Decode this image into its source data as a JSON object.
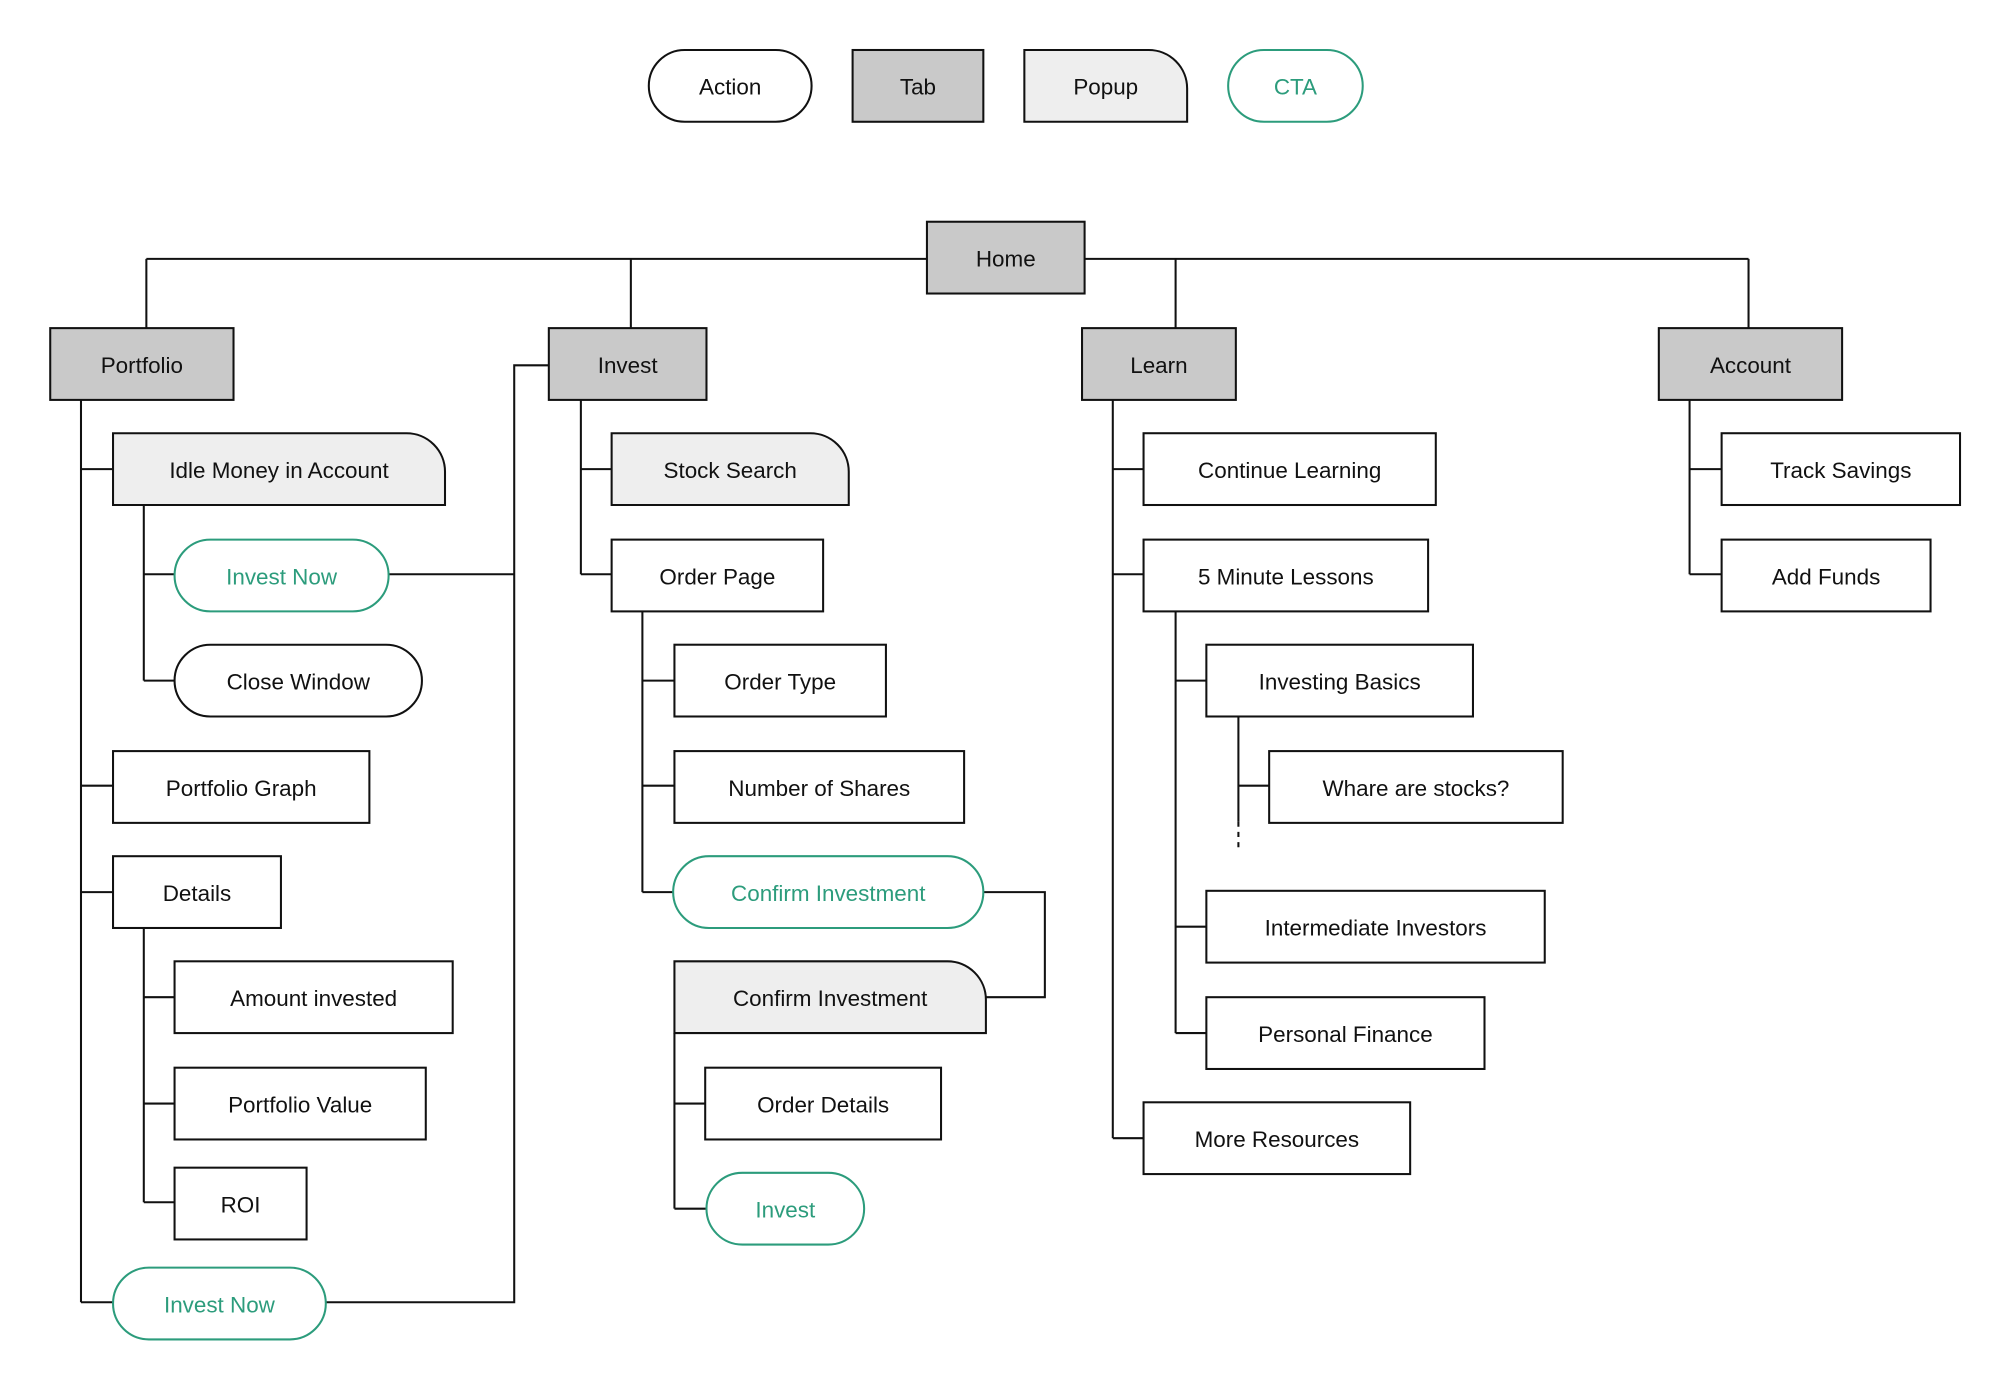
{
  "colors": {
    "tab_fill": "#c9c9c9",
    "popup_fill": "#eeeeee",
    "cta": "#2c9c7c",
    "stroke": "#111111",
    "background": "#ffffff"
  },
  "legend": [
    {
      "id": "lg-action",
      "label": "Action",
      "type": "action"
    },
    {
      "id": "lg-tab",
      "label": "Tab",
      "type": "tab"
    },
    {
      "id": "lg-popup",
      "label": "Popup",
      "type": "popup"
    },
    {
      "id": "lg-cta",
      "label": "CTA",
      "type": "cta"
    }
  ],
  "nodes": [
    {
      "id": "home",
      "label": "Home",
      "type": "tab"
    },
    {
      "id": "portfolio",
      "label": "Portfolio",
      "type": "tab"
    },
    {
      "id": "invest",
      "label": "Invest",
      "type": "tab"
    },
    {
      "id": "learn",
      "label": "Learn",
      "type": "tab"
    },
    {
      "id": "account",
      "label": "Account",
      "type": "tab"
    },
    {
      "id": "idle",
      "label": "Idle Money in Account",
      "type": "popup"
    },
    {
      "id": "investnow1",
      "label": "Invest Now",
      "type": "cta"
    },
    {
      "id": "closewin",
      "label": "Close Window",
      "type": "action"
    },
    {
      "id": "pgraph",
      "label": "Portfolio Graph",
      "type": "page"
    },
    {
      "id": "details",
      "label": "Details",
      "type": "page"
    },
    {
      "id": "amount",
      "label": "Amount invested",
      "type": "page"
    },
    {
      "id": "pvalue",
      "label": "Portfolio Value",
      "type": "page"
    },
    {
      "id": "roi",
      "label": "ROI",
      "type": "page"
    },
    {
      "id": "investnow2",
      "label": "Invest Now",
      "type": "cta"
    },
    {
      "id": "stocksearch",
      "label": "Stock Search",
      "type": "popup"
    },
    {
      "id": "orderpage",
      "label": "Order Page",
      "type": "page"
    },
    {
      "id": "ordertype",
      "label": "Order Type",
      "type": "page"
    },
    {
      "id": "numshares",
      "label": "Number of Shares",
      "type": "page"
    },
    {
      "id": "confirmcta",
      "label": "Confirm Investment",
      "type": "cta"
    },
    {
      "id": "confirmpopup",
      "label": "Confirm Investment",
      "type": "popup"
    },
    {
      "id": "orderdetails",
      "label": "Order Details",
      "type": "page"
    },
    {
      "id": "investcta",
      "label": "Invest",
      "type": "cta"
    },
    {
      "id": "contlearn",
      "label": "Continue Learning",
      "type": "page"
    },
    {
      "id": "fivemin",
      "label": "5 Minute Lessons",
      "type": "page"
    },
    {
      "id": "basics",
      "label": "Investing Basics",
      "type": "page"
    },
    {
      "id": "whatstocks",
      "label": "Whare are stocks?",
      "type": "page"
    },
    {
      "id": "intermediate",
      "label": "Intermediate Investors",
      "type": "page"
    },
    {
      "id": "personal",
      "label": "Personal Finance",
      "type": "page"
    },
    {
      "id": "moreres",
      "label": "More Resources",
      "type": "page"
    },
    {
      "id": "tracksav",
      "label": "Track Savings",
      "type": "page"
    },
    {
      "id": "addfunds",
      "label": "Add Funds",
      "type": "page"
    }
  ]
}
